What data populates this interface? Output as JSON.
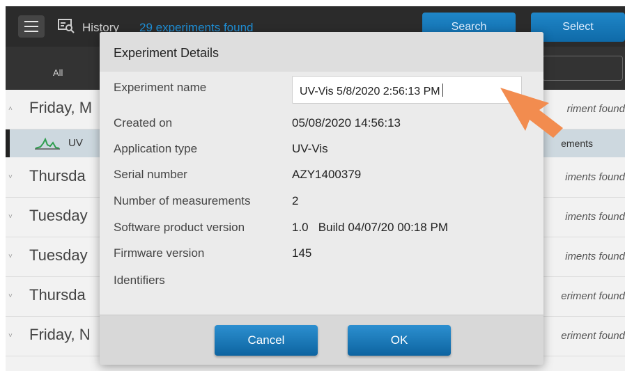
{
  "header": {
    "title": "History",
    "count": "29 experiments found",
    "search_label": "Search",
    "select_label": "Select"
  },
  "filter": {
    "all_label": "All"
  },
  "list": {
    "rows": [
      {
        "day": "Friday, M",
        "found": "riment found",
        "expanded": true
      },
      {
        "day": "Thursda",
        "found": "iments found"
      },
      {
        "day": "Tuesday",
        "found": "iments found"
      },
      {
        "day": "Tuesday",
        "found": "iments found"
      },
      {
        "day": "Thursda",
        "found": "eriment found"
      },
      {
        "day": "Friday, N",
        "found": "eriment found"
      }
    ],
    "subrow": {
      "title": "UV",
      "measurements": "ements"
    }
  },
  "dialog": {
    "title": "Experiment Details",
    "fields": {
      "experiment_name": {
        "label": "Experiment name",
        "value": "UV-Vis 5/8/2020 2:56:13 PM"
      },
      "created_on": {
        "label": "Created on",
        "value": "05/08/2020 14:56:13"
      },
      "application_type": {
        "label": "Application type",
        "value": "UV-Vis"
      },
      "serial_number": {
        "label": "Serial number",
        "value": "AZY1400379"
      },
      "num_measurements": {
        "label": "Number of measurements",
        "value": "2"
      },
      "software_version": {
        "label": "Software product version",
        "value": "1.0   Build 04/07/20 00:18 PM"
      },
      "firmware_version": {
        "label": "Firmware version",
        "value": "145"
      },
      "identifiers": {
        "label": "Identifiers"
      }
    },
    "cancel_label": "Cancel",
    "ok_label": "OK"
  },
  "colors": {
    "accent_blue": "#1f86c8",
    "pointer_arrow": "#f28c4f",
    "topbar": "#2b2b2b"
  },
  "icons": [
    "menu-icon",
    "history-search-icon",
    "spectrum-icon",
    "chevron-up-icon",
    "chevron-down-icon",
    "pointer-arrow-icon"
  ]
}
